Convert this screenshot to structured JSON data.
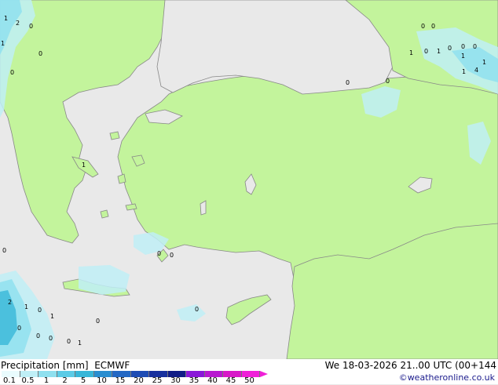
{
  "map": {
    "colors": {
      "sea": "#e9e9e9",
      "land": "#c3f49c",
      "coast": "#888888",
      "border": "#888888",
      "precip_light": "#bfeff6",
      "precip_mid": "#8fe0ef",
      "precip_strong": "#38b6d8"
    },
    "point_labels": [
      {
        "text": "1"
      },
      {
        "text": "2"
      },
      {
        "text": "0"
      },
      {
        "text": "0"
      },
      {
        "text": "0"
      },
      {
        "text": "1"
      },
      {
        "text": "0"
      },
      {
        "text": "1"
      },
      {
        "text": "0"
      },
      {
        "text": "0"
      },
      {
        "text": "0"
      },
      {
        "text": "0"
      },
      {
        "text": "1"
      },
      {
        "text": "0"
      },
      {
        "text": "1"
      },
      {
        "text": "0"
      },
      {
        "text": "0"
      },
      {
        "text": "0"
      },
      {
        "text": "1"
      },
      {
        "text": "4"
      },
      {
        "text": "1"
      },
      {
        "text": "1"
      },
      {
        "text": "0"
      },
      {
        "text": "0"
      },
      {
        "text": "0"
      },
      {
        "text": "0"
      },
      {
        "text": "0"
      },
      {
        "text": "0"
      },
      {
        "text": "2"
      },
      {
        "text": "0"
      },
      {
        "text": "0"
      },
      {
        "text": "1"
      },
      {
        "text": "1"
      },
      {
        "text": "0"
      },
      {
        "text": "1"
      }
    ]
  },
  "legend": {
    "title": "Precipitation [mm]  ECMWF",
    "datetime": "We 18-03-2026 21..00 UTC (00+144",
    "credit": "©weatheronline.co.uk",
    "scale": [
      {
        "label": "0.1",
        "color": "#e9fbfd"
      },
      {
        "label": "0.5",
        "color": "#bfeff6"
      },
      {
        "label": "1",
        "color": "#8fe0ef"
      },
      {
        "label": "2",
        "color": "#5ccbe6"
      },
      {
        "label": "5",
        "color": "#38b6d8"
      },
      {
        "label": "10",
        "color": "#2a8ed0"
      },
      {
        "label": "15",
        "color": "#2468c4"
      },
      {
        "label": "20",
        "color": "#1e4cb4"
      },
      {
        "label": "25",
        "color": "#18309e"
      },
      {
        "label": "30",
        "color": "#101c86"
      },
      {
        "label": "35",
        "color": "#8a18d8"
      },
      {
        "label": "40",
        "color": "#b818d0"
      },
      {
        "label": "45",
        "color": "#d818c8"
      },
      {
        "label": "50",
        "color": "#f020d8"
      }
    ]
  }
}
